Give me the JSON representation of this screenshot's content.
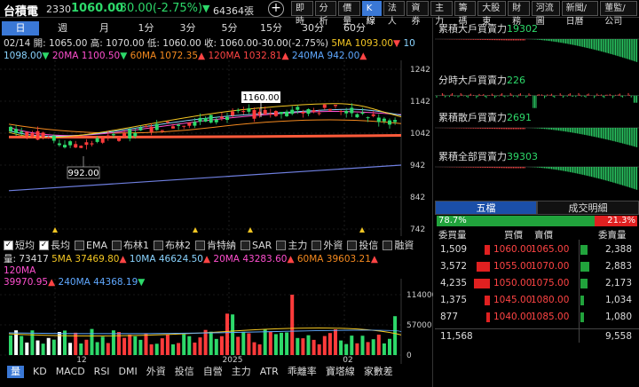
{
  "header": {
    "stock_name": "台積電",
    "stock_code": "2330",
    "price": "1060.00",
    "change": "-30.00(-2.75%)",
    "change_arrow": "▼",
    "volume": "64364張",
    "tabs": [
      "即時",
      "分析",
      "價量",
      "K線",
      "法人",
      "資券",
      "主力",
      "籌碼",
      "大股東",
      "財務",
      "河流圖",
      "新聞/日曆",
      "董監/公司"
    ],
    "active_tab": "K線"
  },
  "periods": [
    "日",
    "週",
    "月",
    "1分",
    "3分",
    "5分",
    "15分",
    "30分",
    "60分"
  ],
  "active_period": "日",
  "ohlc_line": {
    "date": "02/14",
    "open": "開: 1065.00",
    "high": "高: 1070.00",
    "low": "低: 1060.00",
    "close": "收: 1060.00",
    "change": "-30.00(-2.75%)",
    "ma5": "5MA 1093.00",
    "ma10_label": "10",
    "ma10_value": "1098.00",
    "ma20": "20MA 1100.50",
    "ma60": "60MA 1072.35",
    "ma120": "120MA 1032.81",
    "ma240": "240MA 942.00"
  },
  "price_axis": [
    "1242",
    "1142",
    "1042",
    "942",
    "842",
    "742"
  ],
  "annotations": {
    "high": "1160.00",
    "low": "992.00"
  },
  "checks": [
    {
      "label": "短均",
      "on": true
    },
    {
      "label": "長均",
      "on": true
    },
    {
      "label": "EMA",
      "on": false
    },
    {
      "label": "布林1",
      "on": false
    },
    {
      "label": "布林2",
      "on": false
    },
    {
      "label": "肯特納",
      "on": false
    },
    {
      "label": "SAR",
      "on": false
    },
    {
      "label": "主力",
      "on": false
    },
    {
      "label": "外資",
      "on": false
    },
    {
      "label": "投信",
      "on": false
    },
    {
      "label": "融資",
      "on": false
    }
  ],
  "vol_line": {
    "vol": "量: 73417",
    "ma5": "5MA 37469.80",
    "ma10": "10MA 46624.50",
    "ma20": "20MA 43283.60",
    "ma60": "60MA 39603.21",
    "ma120": "120MA",
    "ma120_value": "39970.95",
    "ma240": "240MA 44368.19"
  },
  "vol_axis": [
    "114000",
    "57000",
    "0"
  ],
  "date_labels": [
    "12",
    "2025",
    "02"
  ],
  "indicators": [
    "量",
    "KD",
    "MACD",
    "RSI",
    "DMI",
    "外資",
    "投信",
    "自營",
    "主力",
    "ATR",
    "乖離率",
    "寶塔線",
    "家數差"
  ],
  "active_indicator": "量",
  "mini_charts": [
    {
      "label": "累積大戶買賣力",
      "value": "19302"
    },
    {
      "label": "分時大戶買賣力",
      "value": "226"
    },
    {
      "label": "累積散戶買賣力",
      "value": "2691"
    },
    {
      "label": "累積全部買賣力",
      "value": "39303"
    }
  ],
  "book_tabs": [
    "五檔",
    "成交明細"
  ],
  "active_book_tab": "五檔",
  "ratio": {
    "buy": "78.7%",
    "sell": "21.3%",
    "buy_fraction": 0.787
  },
  "book_headers": {
    "bid_qty": "委買量",
    "bid_price": "買價",
    "ask_price": "賣價",
    "ask_qty": "委賣量"
  },
  "book": [
    {
      "bid_qty": "1,509",
      "bid": "1060.00",
      "ask": "1065.00",
      "ask_qty": "2,388"
    },
    {
      "bid_qty": "3,572",
      "bid": "1055.00",
      "ask": "1070.00",
      "ask_qty": "2,883"
    },
    {
      "bid_qty": "4,235",
      "bid": "1050.00",
      "ask": "1075.00",
      "ask_qty": "2,173"
    },
    {
      "bid_qty": "1,375",
      "bid": "1045.00",
      "ask": "1080.00",
      "ask_qty": "1,034"
    },
    {
      "bid_qty": "877",
      "bid": "1040.00",
      "ask": "1085.00",
      "ask_qty": "1,080"
    }
  ],
  "book_totals": {
    "bid": "11,568",
    "ask": "9,558"
  },
  "colors": {
    "up": "#ff4444",
    "down": "#2dd96a",
    "accent": "#3a78d6"
  }
}
